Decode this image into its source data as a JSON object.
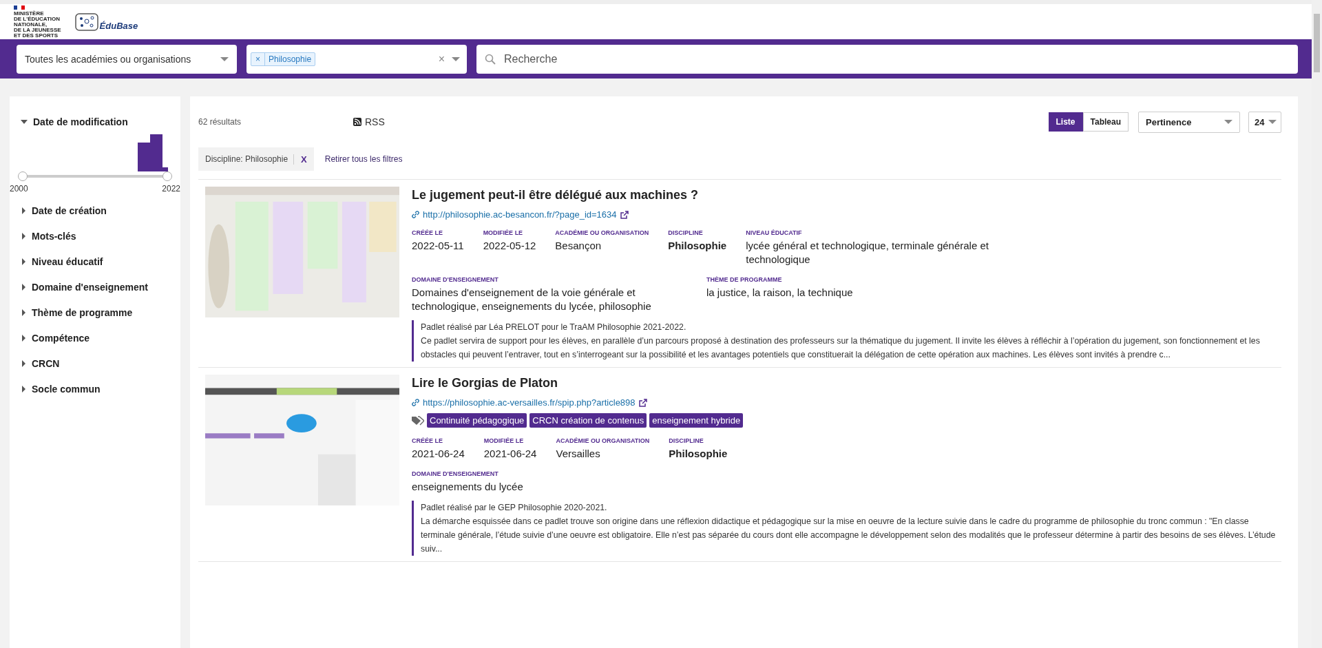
{
  "header": {
    "ministry": [
      "MINISTÈRE",
      "DE L'ÉDUCATION",
      "NATIONALE,",
      "DE LA JEUNESSE",
      "ET DES SPORTS"
    ],
    "brand": "ÉduBase"
  },
  "search_bar": {
    "academy_select": "Toutes les académies ou organisations",
    "discipline_tags": [
      {
        "remove": "×",
        "label": "Philosophie"
      }
    ],
    "clear": "×",
    "search": {
      "placeholder": "Recherche"
    }
  },
  "sidebar": {
    "facets": [
      {
        "label": "Date de modification",
        "expanded": true
      },
      {
        "label": "Date de création",
        "expanded": false
      },
      {
        "label": "Mots-clés",
        "expanded": false
      },
      {
        "label": "Niveau éducatif",
        "expanded": false
      },
      {
        "label": "Domaine d'enseignement",
        "expanded": false
      },
      {
        "label": "Thème de programme",
        "expanded": false
      },
      {
        "label": "Compétence",
        "expanded": false
      },
      {
        "label": "CRCN",
        "expanded": false
      },
      {
        "label": "Socle commun",
        "expanded": false
      }
    ],
    "date_range": {
      "min_label": "2000",
      "max_label": "2022",
      "level": 1
    }
  },
  "results": {
    "count": "62 résultats",
    "rss": "RSS",
    "views": [
      {
        "label": "Liste",
        "selected": true
      },
      {
        "label": "Tableau",
        "selected": false
      }
    ],
    "sort": "Pertinence",
    "per_page": "24",
    "active_filters": [
      {
        "label": "Discipline: Philosophie",
        "remove": "X"
      }
    ],
    "clear_filters": "Retirer tous les filtres",
    "items": [
      {
        "kind": "picture",
        "title": "Le jugement peut-il être délégué aux machines ?",
        "url": "http://philosophie.ac-besancon.fr/?page_id=1634",
        "fields": [
          {
            "label": "CRÉÉE LE",
            "value": "2022-05-11"
          },
          {
            "label": "MODIFIÉE LE",
            "value": "2022-05-12"
          },
          {
            "label": "ACADÉMIE OU ORGANISATION",
            "value": "Besançon"
          },
          {
            "label": "DISCIPLINE",
            "value": "Philosophie",
            "kind": "bold"
          },
          {
            "label": "NIVEAU ÉDUCATIF",
            "value": "lycée général et technologique, terminale générale et technologique"
          }
        ],
        "fields2": [
          {
            "label": "DOMAINE D'ENSEIGNEMENT",
            "value": "Domaines d'enseignement de la voie générale et technologique, enseignements du lycée, philosophie"
          },
          {
            "label": "THÈME DE PROGRAMME",
            "value": "la justice, la raison, la technique"
          }
        ],
        "description": [
          "Padlet réalisé par Léa PRELOT pour le TraAM Philosophie 2021-2022.",
          "Ce padlet servira de support pour les élèves, en parallèle d’un parcours proposé à destination des professeurs sur la thématique du jugement. Il invite les élèves à réfléchir à l’opération du jugement, son fonctionnement et les obstacles qui peuvent l’entraver, tout en s’interrogeant sur la possibilité et les avantages potentiels que constituerait la délégation de cette opération aux machines. Les élèves sont invités à prendre c..."
        ]
      },
      {
        "kind": "picture",
        "title": "Lire le Gorgias de Platon",
        "url": "https://philosophie.ac-versailles.fr/spip.php?article898",
        "tags": [
          "Continuité pédagogique",
          "CRCN création de contenus",
          "enseignement hybride"
        ],
        "fields": [
          {
            "label": "CRÉÉE LE",
            "value": "2021-06-24"
          },
          {
            "label": "MODIFIÉE LE",
            "value": "2021-06-24"
          },
          {
            "label": "ACADÉMIE OU ORGANISATION",
            "value": "Versailles"
          },
          {
            "label": "DISCIPLINE",
            "value": "Philosophie",
            "kind": "bold"
          }
        ],
        "fields2": [
          {
            "label": "DOMAINE D'ENSEIGNEMENT",
            "value": "enseignements du lycée"
          }
        ],
        "description": [
          "Padlet réalisé par le GEP Philosophie 2020-2021.",
          "La démarche esquissée dans ce padlet trouve son origine dans une réflexion didactique et pédagogique sur la mise en oeuvre de la lecture suivie dans le cadre du programme de philosophie du tronc commun : \"En classe terminale générale, l’étude suivie d’une oeuvre est obligatoire. Elle n’est pas séparée du cours dont elle accompagne le développement selon des modalités que le professeur détermine à partir des besoins de ses élèves. L’étude suiv..."
        ]
      }
    ]
  }
}
